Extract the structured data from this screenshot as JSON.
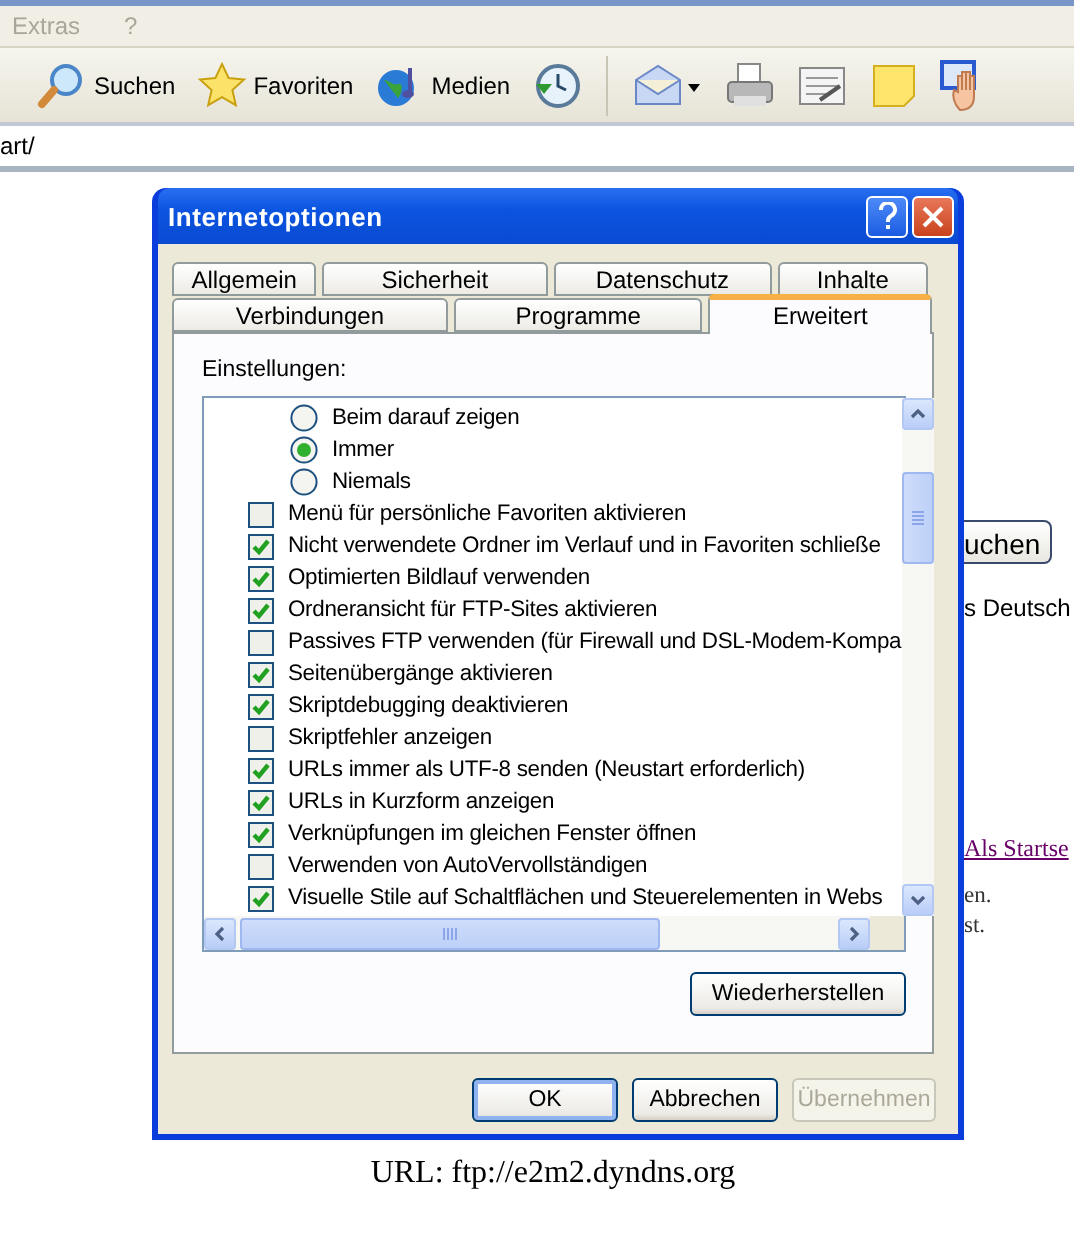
{
  "browser": {
    "menu": [
      "Extras",
      "?"
    ],
    "toolbar": [
      {
        "kind": "search",
        "label": "Suchen"
      },
      {
        "kind": "favorites",
        "label": "Favoriten"
      },
      {
        "kind": "media",
        "label": "Medien"
      },
      {
        "kind": "history"
      },
      {
        "kind": "mail"
      },
      {
        "kind": "print"
      },
      {
        "kind": "edit"
      },
      {
        "kind": "note"
      },
      {
        "kind": "hand"
      }
    ],
    "address": "art/",
    "page": [
      {
        "kind": "button",
        "text": "uchen"
      },
      {
        "kind": "text",
        "text": "s Deutsch"
      },
      {
        "kind": "link",
        "text": "Als Startse"
      },
      {
        "kind": "small",
        "text": "en."
      },
      {
        "kind": "small",
        "text": "st."
      }
    ]
  },
  "dialog": {
    "title": "Internetoptionen",
    "tab_rows": [
      [
        {
          "label": "Allgemein",
          "selected": false
        },
        {
          "label": "Sicherheit",
          "selected": false
        },
        {
          "label": "Datenschutz",
          "selected": false
        },
        {
          "label": "Inhalte",
          "selected": false
        }
      ],
      [
        {
          "label": "Verbindungen",
          "selected": false
        },
        {
          "label": "Programme",
          "selected": false
        },
        {
          "label": "Erweitert",
          "selected": true
        }
      ]
    ],
    "settings_label": "Einstellungen:",
    "settings": [
      {
        "kind": "radio",
        "label": "Beim darauf zeigen",
        "selected": false
      },
      {
        "kind": "radio",
        "label": "Immer",
        "selected": true
      },
      {
        "kind": "radio",
        "label": "Niemals",
        "selected": false
      },
      {
        "kind": "checkbox",
        "label": "Menü für persönliche Favoriten aktivieren",
        "checked": false
      },
      {
        "kind": "checkbox",
        "label": "Nicht verwendete Ordner im Verlauf und in Favoriten schließe",
        "checked": true
      },
      {
        "kind": "checkbox",
        "label": "Optimierten Bildlauf verwenden",
        "checked": true
      },
      {
        "kind": "checkbox",
        "label": "Ordneransicht für FTP-Sites aktivieren",
        "checked": true
      },
      {
        "kind": "checkbox",
        "label": "Passives FTP verwenden (für Firewall und DSL-Modem-Kompa",
        "checked": false
      },
      {
        "kind": "checkbox",
        "label": "Seitenübergänge aktivieren",
        "checked": true
      },
      {
        "kind": "checkbox",
        "label": "Skriptdebugging deaktivieren",
        "checked": true
      },
      {
        "kind": "checkbox",
        "label": "Skriptfehler anzeigen",
        "checked": false
      },
      {
        "kind": "checkbox",
        "label": "URLs immer als UTF-8 senden (Neustart erforderlich)",
        "checked": true
      },
      {
        "kind": "checkbox",
        "label": "URLs in Kurzform anzeigen",
        "checked": true
      },
      {
        "kind": "checkbox",
        "label": "Verknüpfungen im gleichen Fenster öffnen",
        "checked": true
      },
      {
        "kind": "checkbox",
        "label": "Verwenden von AutoVervollständigen",
        "checked": false
      },
      {
        "kind": "checkbox",
        "label": "Visuelle Stile auf Schaltflächen und Steuerelementen in Webs",
        "checked": true
      }
    ],
    "restore_button": "Wiederherstellen",
    "buttons": [
      {
        "label": "OK",
        "default": true,
        "disabled": false
      },
      {
        "label": "Abbrechen",
        "default": false,
        "disabled": false
      },
      {
        "label": "Übernehmen",
        "default": false,
        "disabled": true
      }
    ]
  },
  "caption": "URL: ftp://e2m2.dyndns.org"
}
